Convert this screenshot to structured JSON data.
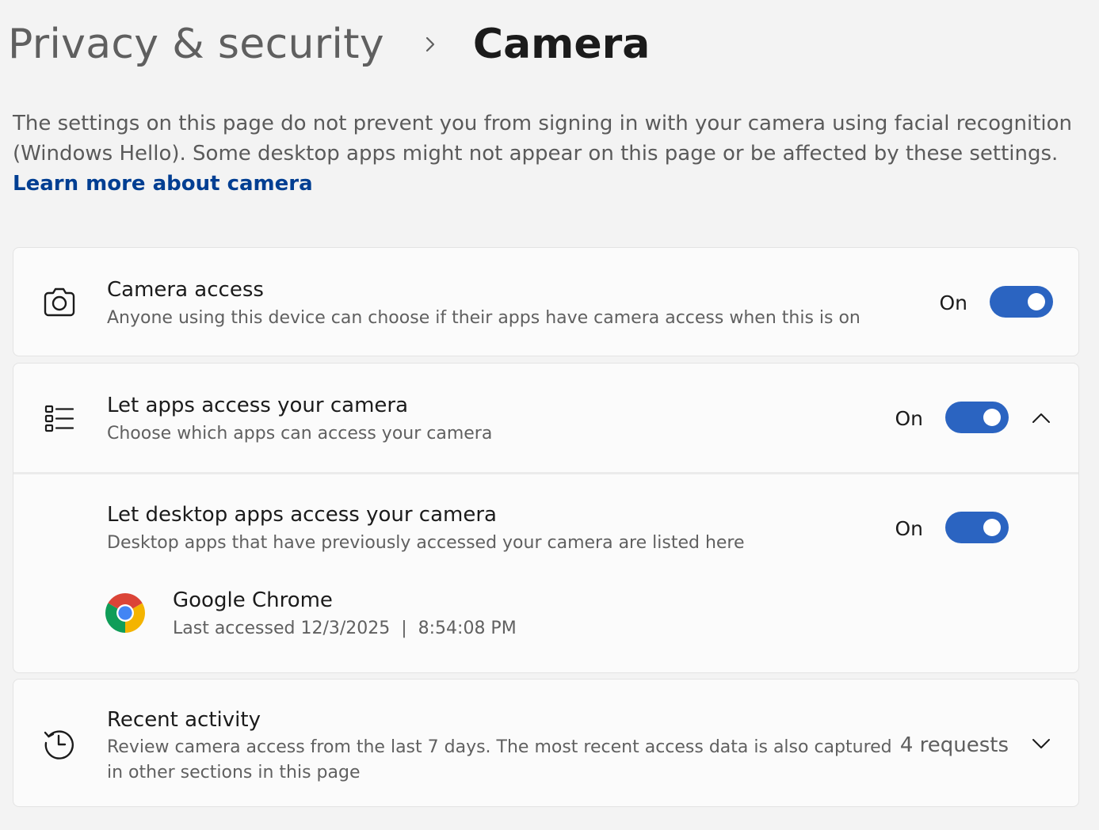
{
  "breadcrumb": {
    "parent": "Privacy & security",
    "current": "Camera"
  },
  "description": {
    "text": "The settings on this page do not prevent you from signing in with your camera using facial recognition (Windows Hello). Some desktop apps might not appear on this page or be affected by these settings.",
    "link_text": "Learn more about camera"
  },
  "camera_access": {
    "title": "Camera access",
    "subtitle": "Anyone using this device can choose if their apps have camera access when this is on",
    "state": "On",
    "enabled": true,
    "icon": "camera-icon"
  },
  "apps_access": {
    "title": "Let apps access your camera",
    "subtitle": "Choose which apps can access your camera",
    "state": "On",
    "enabled": true,
    "icon": "app-list-icon",
    "expanded": true
  },
  "desktop_apps": {
    "title": "Let desktop apps access your camera",
    "subtitle": "Desktop apps that have previously accessed your camera are listed here",
    "state": "On",
    "enabled": true,
    "apps": [
      {
        "name": "Google Chrome",
        "last_accessed": "Last accessed 12/3/2025  |  8:54:08 PM",
        "icon": "chrome-icon"
      }
    ]
  },
  "recent_activity": {
    "title": "Recent activity",
    "subtitle_line1": "Review camera access from the last 7 days. The most recent access data is also captured",
    "subtitle_line2": "in other sections in this page",
    "count": "4 requests",
    "icon": "history-icon"
  },
  "colors": {
    "accent": "#2b64c1",
    "link": "#003e92",
    "background": "#f3f3f3",
    "card": "#fbfbfb"
  }
}
